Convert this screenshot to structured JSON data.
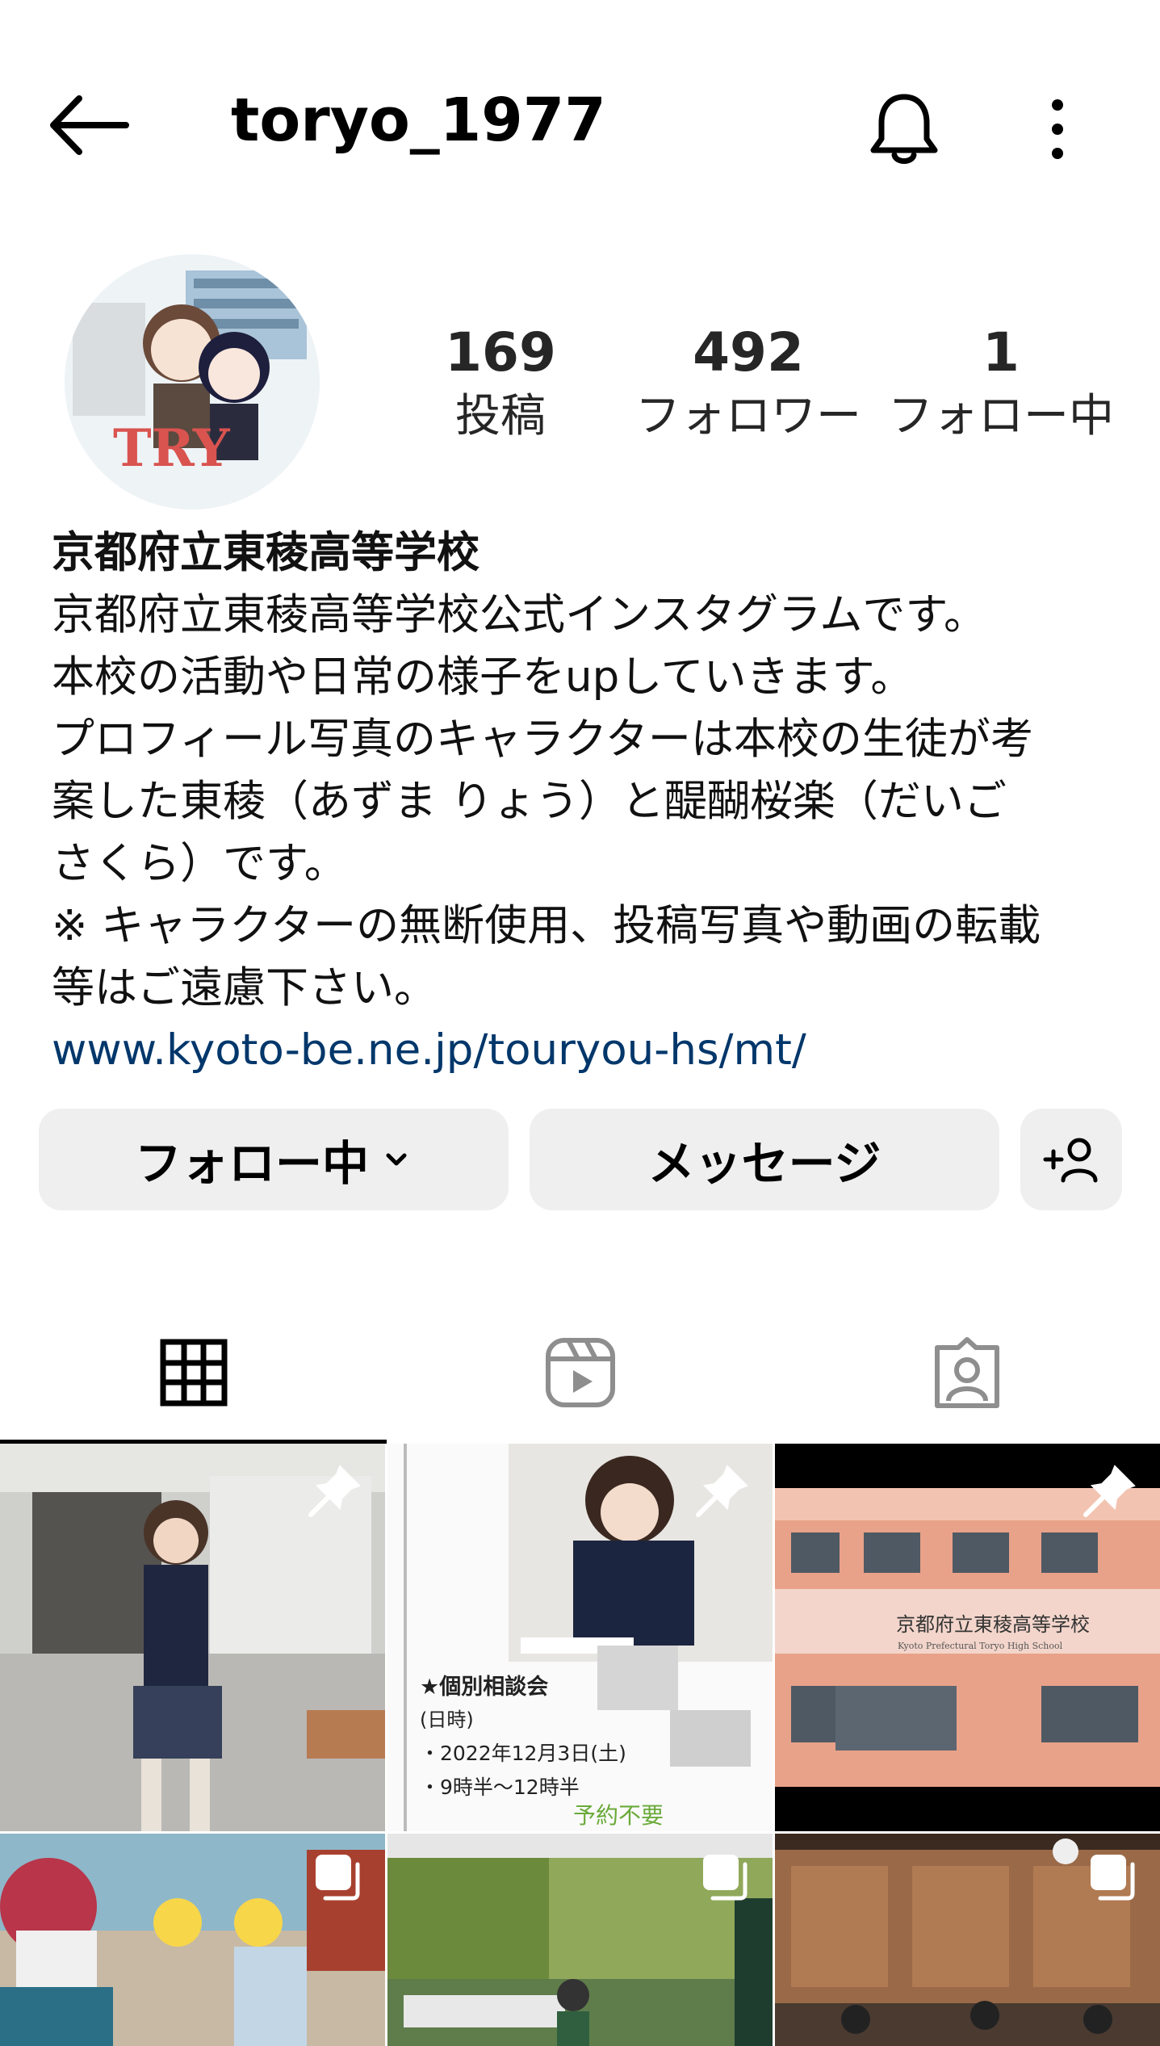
{
  "header": {
    "username": "toryo_1977",
    "back_icon": "arrow-left-icon",
    "notification_icon": "bell-icon",
    "menu_icon": "more-vertical-icon"
  },
  "profile": {
    "avatar_text": "TRY",
    "stats": [
      {
        "value": "169",
        "label": "投稿"
      },
      {
        "value": "492",
        "label": "フォロワー"
      },
      {
        "value": "1",
        "label": "フォロー中"
      }
    ]
  },
  "bio": {
    "name": "京都府立東稜高等学校",
    "lines": [
      "京都府立東稜高等学校公式インスタグラムです。",
      "本校の活動や日常の様子をupしていきます。",
      "プロフィール写真のキャラクターは本校の生徒が考",
      "案した東稜（あずま りょう）と醍醐桜楽（だいご",
      "さくら）です。",
      "※ キャラクターの無断使用、投稿写真や動画の転載",
      "等はご遠慮下さい。"
    ],
    "link": "www.kyoto-be.ne.jp/touryou-hs/mt/"
  },
  "actions": {
    "following": "フォロー中",
    "message": "メッセージ",
    "add_user_icon": "add-user-icon"
  },
  "tabs": [
    {
      "icon": "grid-icon",
      "active": true
    },
    {
      "icon": "reels-icon",
      "active": false
    },
    {
      "icon": "tagged-icon",
      "active": false
    }
  ],
  "posts": {
    "post2": {
      "heading": "★個別相談会",
      "date_label": "(日時)",
      "date": "・2022年12月3日(土)",
      "time": "・9時半〜12時半",
      "note": "予約不要"
    },
    "post3": {
      "school_name": "京都府立東稜高等学校",
      "school_name_en": "Kyoto Prefectural Toryo High School"
    }
  },
  "colors": {
    "link": "#00376b",
    "button_bg": "#efefef"
  }
}
